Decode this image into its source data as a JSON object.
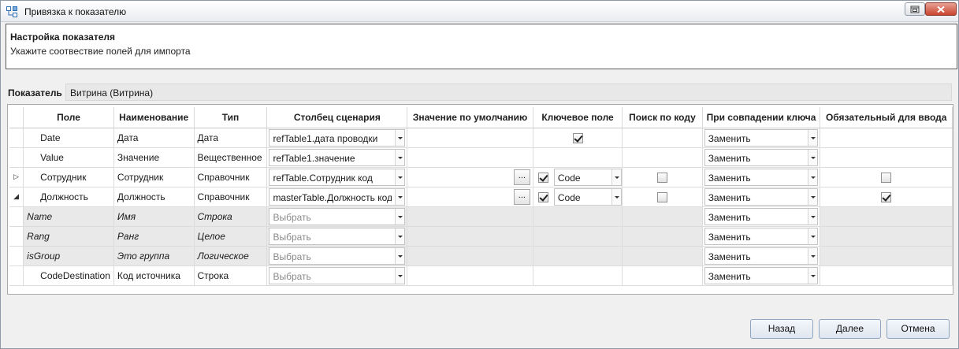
{
  "window": {
    "title": "Привязка к показателю"
  },
  "header": {
    "title": "Настройка показателя",
    "subtitle": "Укажите соотвествие полей для импорта"
  },
  "indicator": {
    "label": "Показатель",
    "value": "Витрина (Витрина)"
  },
  "columns": [
    "Поле",
    "Наименование",
    "Тип",
    "Столбец сценария",
    "Значение по умолчанию",
    "Ключевое поле",
    "Поиск по коду",
    "При совпадении ключа",
    "Обязательный для ввода"
  ],
  "rows": [
    {
      "expander": "",
      "field": "Date",
      "name": "Дата",
      "type": "Дата",
      "scenario": "refTable1.дата проводки",
      "scenario_placeholder": false,
      "has_default_button": false,
      "key_checked": true,
      "key_combo": "",
      "search_checkbox": false,
      "search_checked": false,
      "on_match": "Заменить",
      "required_checkbox": false,
      "required_checked": false,
      "child": false
    },
    {
      "expander": "",
      "field": "Value",
      "name": "Значение",
      "type": "Вещественное",
      "scenario": "refTable1.значение",
      "scenario_placeholder": false,
      "has_default_button": false,
      "key_checked": false,
      "key_combo": "",
      "search_checkbox": false,
      "search_checked": false,
      "on_match": "Заменить",
      "required_checkbox": false,
      "required_checked": false,
      "child": false
    },
    {
      "expander": "▷",
      "field": "Сотрудник",
      "name": "Сотрудник",
      "type": "Справочник",
      "scenario": "refTable.Сотрудник код",
      "scenario_placeholder": false,
      "has_default_button": true,
      "key_checked": true,
      "key_combo": "Code",
      "search_checkbox": true,
      "search_checked": false,
      "on_match": "Заменить",
      "required_checkbox": true,
      "required_checked": false,
      "child": false
    },
    {
      "expander": "◢",
      "field": "Должность",
      "name": "Должность",
      "type": "Справочник",
      "scenario": "masterTable.Должность код",
      "scenario_placeholder": false,
      "has_default_button": true,
      "key_checked": true,
      "key_combo": "Code",
      "search_checkbox": true,
      "search_checked": false,
      "on_match": "Заменить",
      "required_checkbox": true,
      "required_checked": true,
      "child": false
    },
    {
      "expander": "",
      "field": "Name",
      "name": "Имя",
      "type": "Строка",
      "scenario": "Выбрать",
      "scenario_placeholder": true,
      "has_default_button": false,
      "key_checked": false,
      "key_combo": "",
      "search_checkbox": false,
      "search_checked": false,
      "on_match": "Заменить",
      "required_checkbox": false,
      "required_checked": false,
      "child": true
    },
    {
      "expander": "",
      "field": "Rang",
      "name": "Ранг",
      "type": "Целое",
      "scenario": "Выбрать",
      "scenario_placeholder": true,
      "has_default_button": false,
      "key_checked": false,
      "key_combo": "",
      "search_checkbox": false,
      "search_checked": false,
      "on_match": "Заменить",
      "required_checkbox": false,
      "required_checked": false,
      "child": true
    },
    {
      "expander": "",
      "field": "isGroup",
      "name": "Это группа",
      "type": "Логическое",
      "scenario": "Выбрать",
      "scenario_placeholder": true,
      "has_default_button": false,
      "key_checked": false,
      "key_combo": "",
      "search_checkbox": false,
      "search_checked": false,
      "on_match": "Заменить",
      "required_checkbox": false,
      "required_checked": false,
      "child": true
    },
    {
      "expander": "",
      "field": "CodeDestination",
      "name": "Код источника",
      "type": "Строка",
      "scenario": "Выбрать",
      "scenario_placeholder": true,
      "has_default_button": false,
      "key_checked": false,
      "key_combo": "",
      "search_checkbox": false,
      "search_checked": false,
      "on_match": "Заменить",
      "required_checkbox": false,
      "required_checked": false,
      "child": false
    }
  ],
  "date_row_key_checkbox": true,
  "default_button_label": "...",
  "buttons": {
    "back": "Назад",
    "next": "Далее",
    "cancel": "Отмена"
  },
  "colors": {
    "close_button": "#c9442e",
    "child_row_bg": "#e9e9e9",
    "indicator_bg": "#e8e8e8"
  }
}
